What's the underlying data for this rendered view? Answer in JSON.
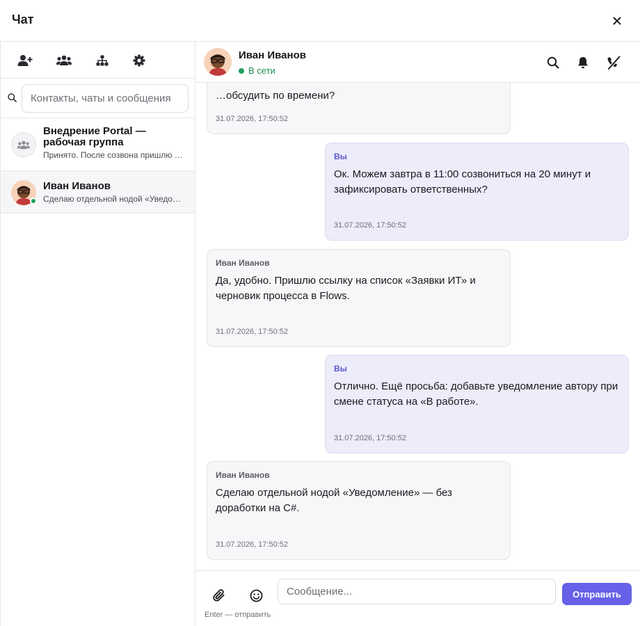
{
  "window": {
    "title": "Чат"
  },
  "sidebar": {
    "tools": [
      {
        "icon": "add-user-icon"
      },
      {
        "icon": "group-icon"
      },
      {
        "icon": "org-structure-icon"
      },
      {
        "icon": "gear-icon"
      }
    ],
    "search": {
      "placeholder": "Контакты, чаты и сообщения"
    },
    "conversations": [
      {
        "name": "Внедрение Portal — рабочая группа",
        "preview": "Принято. После созвона пришлю …",
        "icon": "group-icon"
      },
      {
        "name": "Иван Иванов",
        "preview": "Сделаю отдельной нодой «Уведомление» — без доработки на C#.",
        "online": true
      }
    ]
  },
  "chat": {
    "contact_name": "Иван Иванов",
    "status": "В сети",
    "colors": {
      "accent": "#6661e8",
      "online": "#1e9e5a",
      "outgoing_bg": "#ececfa"
    },
    "messages": [
      {
        "direction": "in",
        "author": "",
        "text": "…обсудить по времени?",
        "time": "31.07.2026, 17:50:52"
      },
      {
        "direction": "out",
        "author": "Вы",
        "text": "Ок. Можем завтра в 11:00 созвониться на 20 минут и зафиксировать ответственных?",
        "time": "31.07.2026, 17:50:52"
      },
      {
        "direction": "in",
        "author": "Иван Иванов",
        "text": "Да, удобно. Пришлю ссылку на список «Заявки ИТ» и черновик процесса в Flows.",
        "time": "31.07.2026, 17:50:52"
      },
      {
        "direction": "out",
        "author": "Вы",
        "text": "Отлично. Ещё просьба: добавьте уведомление автору при смене статуса на «В работе».",
        "time": "31.07.2026, 17:50:52"
      },
      {
        "direction": "in",
        "author": "Иван Иванов",
        "text": "Сделаю отдельной нодой «Уведомление» — без доработки на C#.",
        "time": "31.07.2026, 17:50:52"
      }
    ]
  },
  "composer": {
    "placeholder": "Сообщение...",
    "send_label": "Отправить",
    "hint": "Enter — отправить"
  }
}
